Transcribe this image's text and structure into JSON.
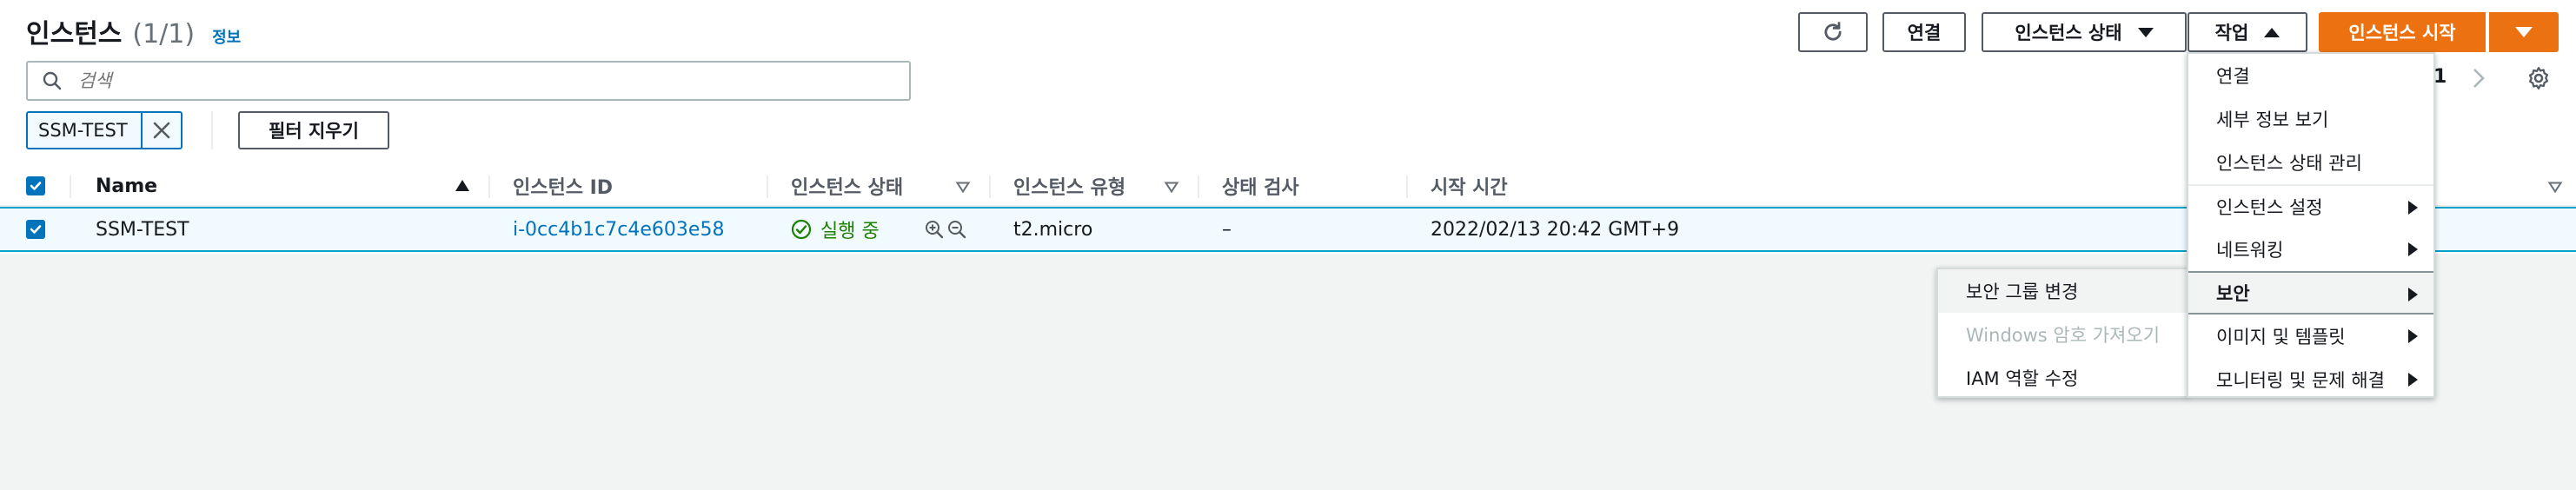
{
  "header": {
    "title": "인스턴스",
    "count": "(1/1)",
    "info_link": "정보"
  },
  "toolbar": {
    "connect_label": "연결",
    "instance_state_label": "인스턴스 상태",
    "actions_label": "작업",
    "launch_label": "인스턴스 시작"
  },
  "search": {
    "placeholder": "검색"
  },
  "filter": {
    "token_label": "SSM-TEST",
    "clear_label": "필터 지우기"
  },
  "pagination": {
    "page": "1"
  },
  "table": {
    "columns": {
      "name": "Name",
      "instance_id": "인스턴스 ID",
      "instance_state": "인스턴스 상태",
      "instance_type": "인스턴스 유형",
      "status_check": "상태 검사",
      "launch_time": "시작 시간"
    },
    "rows": [
      {
        "selected": true,
        "name": "SSM-TEST",
        "instance_id": "i-0cc4b1c7c4e603e58",
        "state": "실행 중",
        "type": "t2.micro",
        "status_check": "–",
        "launch_time": "2022/02/13 20:42 GMT+9"
      }
    ]
  },
  "actions_menu": {
    "items": [
      {
        "label": "연결",
        "submenu": false
      },
      {
        "label": "세부 정보 보기",
        "submenu": false
      },
      {
        "label": "인스턴스 상태 관리",
        "submenu": false
      },
      {
        "label": "인스턴스 설정",
        "submenu": true
      },
      {
        "label": "네트워킹",
        "submenu": true
      },
      {
        "label": "보안",
        "submenu": true,
        "active": true
      },
      {
        "label": "이미지 및 템플릿",
        "submenu": true
      },
      {
        "label": "모니터링 및 문제 해결",
        "submenu": true
      }
    ]
  },
  "security_submenu": {
    "items": [
      {
        "label": "보안 그룹 변경",
        "disabled": false
      },
      {
        "label": "Windows 암호 가져오기",
        "disabled": true
      },
      {
        "label": "IAM 역할 수정",
        "disabled": false
      }
    ]
  },
  "colors": {
    "primary": "#ec7211",
    "link": "#0073bb",
    "running": "#1d8102",
    "selected_row_bg": "#f1faff"
  }
}
